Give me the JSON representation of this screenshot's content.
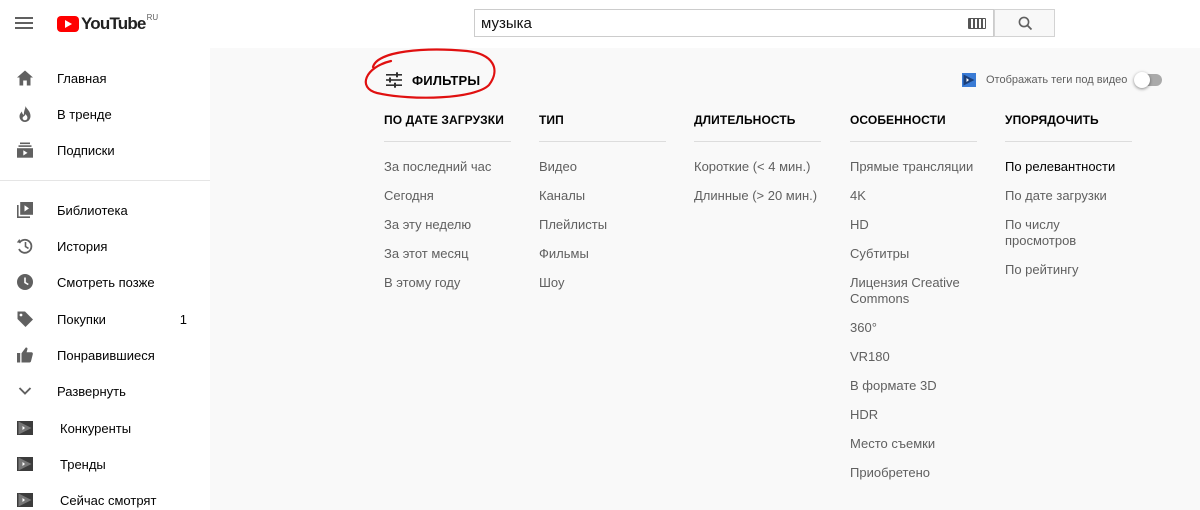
{
  "header": {
    "logo_text": "YouTube",
    "logo_region": "RU",
    "search_value": "музыка",
    "icons": [
      "menu-icon",
      "keyboard-icon",
      "search-icon"
    ]
  },
  "sidebar": {
    "items": [
      {
        "label": "Главная",
        "icon": "home-icon"
      },
      {
        "label": "В тренде",
        "icon": "flame-icon"
      },
      {
        "label": "Подписки",
        "icon": "subscriptions-icon"
      },
      {
        "label": "Библиотека",
        "icon": "library-icon"
      },
      {
        "label": "История",
        "icon": "history-icon"
      },
      {
        "label": "Смотреть позже",
        "icon": "clock-icon"
      },
      {
        "label": "Покупки",
        "icon": "tag-icon",
        "count": "1"
      },
      {
        "label": "Понравившиеся",
        "icon": "thumb-up-icon"
      },
      {
        "label": "Развернуть",
        "icon": "chevron-down-icon"
      },
      {
        "label": "Конкуренты",
        "icon": "extension-icon"
      },
      {
        "label": "Тренды",
        "icon": "extension-icon"
      },
      {
        "label": "Сейчас смотрят",
        "icon": "extension-icon"
      }
    ]
  },
  "filters": {
    "title": "ФИЛЬТРЫ",
    "show_tags_label": "Отображать теги под видео",
    "show_tags_on": false,
    "columns": [
      {
        "heading": "ПО ДАТЕ ЗАГРУЗКИ",
        "options": [
          {
            "label": "За последний час"
          },
          {
            "label": "Сегодня"
          },
          {
            "label": "За эту неделю"
          },
          {
            "label": "За этот месяц"
          },
          {
            "label": "В этому году"
          }
        ]
      },
      {
        "heading": "ТИП",
        "options": [
          {
            "label": "Видео"
          },
          {
            "label": "Каналы"
          },
          {
            "label": "Плейлисты"
          },
          {
            "label": "Фильмы"
          },
          {
            "label": "Шоу"
          }
        ]
      },
      {
        "heading": "ДЛИТЕЛЬНОСТЬ",
        "options": [
          {
            "label": "Короткие (< 4 мин.)"
          },
          {
            "label": "Длинные (> 20 мин.)"
          }
        ]
      },
      {
        "heading": "ОСОБЕННОСТИ",
        "options": [
          {
            "label": "Прямые трансляции"
          },
          {
            "label": "4K"
          },
          {
            "label": "HD"
          },
          {
            "label": "Субтитры"
          },
          {
            "label": "Лицензия Creative Commons"
          },
          {
            "label": "360°"
          },
          {
            "label": "VR180"
          },
          {
            "label": "В формате 3D"
          },
          {
            "label": "HDR"
          },
          {
            "label": "Место съемки"
          },
          {
            "label": "Приобретено"
          }
        ]
      },
      {
        "heading": "УПОРЯДОЧИТЬ",
        "options": [
          {
            "label": "По релевантности",
            "active": true
          },
          {
            "label": "По дате загрузки"
          },
          {
            "label": "По числу просмотров"
          },
          {
            "label": "По рейтингу"
          }
        ]
      }
    ]
  },
  "colors": {
    "brand_red": "#ff0000",
    "annotation_red": "#e01010",
    "text_primary": "#030303",
    "text_secondary": "#606060",
    "background": "#f9f9f9"
  }
}
